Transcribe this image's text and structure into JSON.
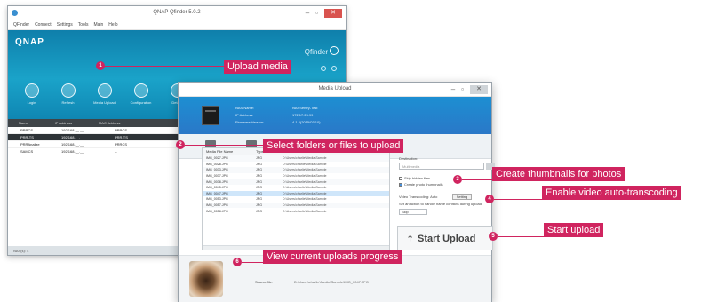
{
  "back_window": {
    "title": "QNAP Qfinder 5.0.2",
    "menu": [
      "QFinder",
      "Connect",
      "Settings",
      "Tools",
      "Main",
      "Help"
    ],
    "logo": "QNAP",
    "brand": "Qfinder",
    "tools": [
      "Login",
      "Refresh",
      "Media Upload",
      "Configuration",
      "Details"
    ],
    "table_headers": [
      "Name",
      "IP Address",
      "MAC Address"
    ],
    "rows": [
      {
        "name": "PRRCS",
        "ip": "192.168.__.__",
        "mac": "PRRCS"
      },
      {
        "name": "PRR-TS",
        "ip": "192.168.__.__",
        "mac": "PRR-TS",
        "selected": true
      },
      {
        "name": "PRRAnalize",
        "ip": "192.168.__.__",
        "mac": "PRRCS"
      },
      {
        "name": "SAMCS",
        "ip": "192.168.__.__",
        "mac": "--"
      }
    ],
    "status": "NAS(s): 4"
  },
  "front_window": {
    "title": "Media Upload",
    "info": {
      "name_label": "NAS Name:",
      "name_value": "NASSentry-Test",
      "ip_label": "IP Address:",
      "ip_value": "172.17.25.99",
      "fw_label": "Firmware Version:",
      "fw_value": "4.1.4(2015/03/10)"
    },
    "table_headers": [
      "Media File Name",
      "Type",
      "Path"
    ],
    "files": [
      {
        "name": "IMG_0027.JPG",
        "type": "JPG",
        "path": "D:\\Users\\charlie\\Media\\Sample"
      },
      {
        "name": "IMG_0028.JPG",
        "type": "JPG",
        "path": "D:\\Users\\charlie\\Media\\Sample"
      },
      {
        "name": "IMG_0033.JPG",
        "type": "JPG",
        "path": "D:\\Users\\charlie\\Media\\Sample"
      },
      {
        "name": "IMG_0037.JPG",
        "type": "JPG",
        "path": "D:\\Users\\charlie\\Media\\Sample"
      },
      {
        "name": "IMG_0038.JPG",
        "type": "JPG",
        "path": "D:\\Users\\charlie\\Media\\Sample"
      },
      {
        "name": "IMG_0045.JPG",
        "type": "JPG",
        "path": "D:\\Users\\charlie\\Media\\Sample"
      },
      {
        "name": "IMG_0047.JPG",
        "type": "JPG",
        "path": "D:\\Users\\charlie\\Media\\Sample",
        "selected": true
      },
      {
        "name": "IMG_0053.JPG",
        "type": "JPG",
        "path": "D:\\Users\\charlie\\Media\\Sample"
      },
      {
        "name": "IMG_0057.JPG",
        "type": "JPG",
        "path": "D:\\Users\\charlie\\Media\\Sample"
      },
      {
        "name": "IMG_0058.JPG",
        "type": "JPG",
        "path": "D:\\Users\\charlie\\Media\\Sample"
      }
    ],
    "destination_label": "Destination:",
    "destination_value": "Multimedia",
    "skip_hidden": "Skip hidden files",
    "create_thumbnails": "Create photo thumbnails",
    "video_transcoding": "Video Transcoding: Auto",
    "setting_button": "Setting",
    "conflict_policy": "Set an action to handle name conflicts during upload",
    "conflict_value": "Skip",
    "start_upload": "Start Upload",
    "source_label": "Source file:",
    "source_value": "D:\\Users\\charlie\\Media\\Sample\\IMG_0047.JPG"
  },
  "callouts": [
    {
      "num": "1",
      "text": "Upload media"
    },
    {
      "num": "2",
      "text": "Select folders or files to upload"
    },
    {
      "num": "3",
      "text": "Create thumbnails for photos"
    },
    {
      "num": "4",
      "text": "Enable video auto-transcoding"
    },
    {
      "num": "5",
      "text": "Start upload"
    },
    {
      "num": "6",
      "text": "View current uploads progress"
    }
  ],
  "colors": {
    "callout": "#d0245f",
    "banner": "#1aa3c9"
  }
}
